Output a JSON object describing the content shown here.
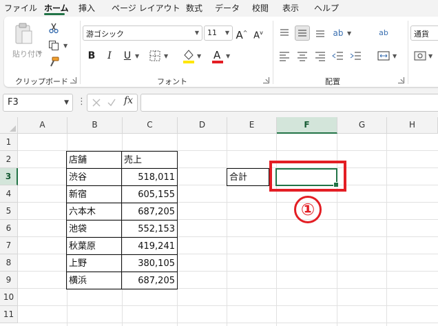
{
  "menu": {
    "tabs": [
      "ファイル",
      "ホーム",
      "挿入",
      "ページ レイアウト",
      "数式",
      "データ",
      "校閲",
      "表示",
      "ヘルプ"
    ],
    "active_tab": "ホーム"
  },
  "ribbon": {
    "clipboard": {
      "paste_label": "貼り付け",
      "group_label": "クリップボード"
    },
    "font": {
      "font_name": "游ゴシック",
      "font_size": "11",
      "bold": "B",
      "italic": "I",
      "underline": "U",
      "group_label": "フォント"
    },
    "alignment": {
      "group_label": "配置"
    },
    "number": {
      "format": "通貨"
    }
  },
  "formula_bar": {
    "name_box": "F3",
    "fx_label": "fx",
    "formula": ""
  },
  "grid": {
    "columns": [
      "A",
      "B",
      "C",
      "D",
      "E",
      "F",
      "G",
      "H"
    ],
    "rows": [
      "1",
      "2",
      "3",
      "4",
      "5",
      "6",
      "7",
      "8",
      "9",
      "10",
      "11"
    ],
    "selected_column": "F",
    "selected_row": "3",
    "table": {
      "headers": [
        "店舗",
        "売上"
      ],
      "rows": [
        [
          "渋谷",
          "518,011"
        ],
        [
          "新宿",
          "605,155"
        ],
        [
          "六本木",
          "687,205"
        ],
        [
          "池袋",
          "552,153"
        ],
        [
          "秋葉原",
          "419,241"
        ],
        [
          "上野",
          "380,105"
        ],
        [
          "横浜",
          "687,205"
        ]
      ]
    },
    "total_label": "合計"
  },
  "annotation": {
    "step_number": "①",
    "color": "#e31e24"
  },
  "colors": {
    "accent": "#217346",
    "font_color_bar": "#e31e24",
    "fill_color_bar": "#ffe600"
  }
}
